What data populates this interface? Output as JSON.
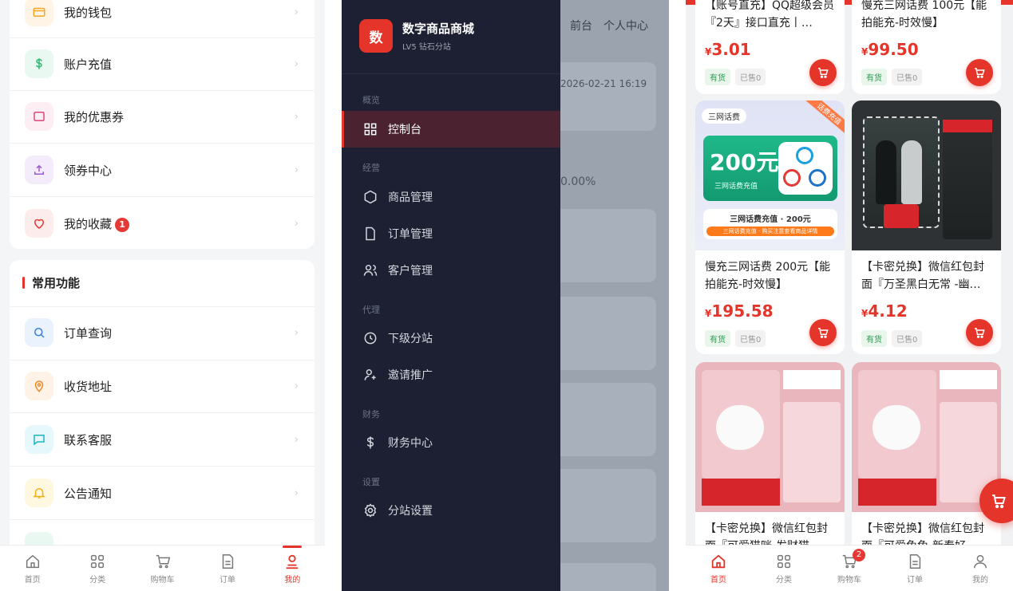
{
  "profile": {
    "account_items": [
      {
        "label": "我的钱包",
        "icon": "wallet-icon",
        "color": "#f5a623",
        "bg": "#fff4e6"
      },
      {
        "label": "账户充值",
        "icon": "dollar-icon",
        "color": "#2eb872",
        "bg": "#e9f8f0"
      },
      {
        "label": "我的优惠券",
        "icon": "coupon-icon",
        "color": "#e0457b",
        "bg": "#fdeef3"
      },
      {
        "label": "领券中心",
        "icon": "upload-icon",
        "color": "#9b59d0",
        "bg": "#f4ecfb"
      },
      {
        "label": "我的收藏",
        "icon": "heart-icon",
        "color": "#e53935",
        "bg": "#fdecec",
        "badge": "1"
      }
    ],
    "common_title": "常用功能",
    "common_items": [
      {
        "label": "订单查询",
        "icon": "search-icon",
        "color": "#3b7ddd",
        "bg": "#eaf2fd"
      },
      {
        "label": "收货地址",
        "icon": "location-icon",
        "color": "#f08a24",
        "bg": "#fff2e6"
      },
      {
        "label": "联系客服",
        "icon": "chat-icon",
        "color": "#1bb3c9",
        "bg": "#e6f8fb"
      },
      {
        "label": "公告通知",
        "icon": "bell-icon",
        "color": "#f5b014",
        "bg": "#fff8e1"
      }
    ],
    "chevron": "›"
  },
  "tabbar_left": {
    "tabs": [
      {
        "label": "首页",
        "icon": "home-icon"
      },
      {
        "label": "分类",
        "icon": "category-icon"
      },
      {
        "label": "购物车",
        "icon": "cart-icon"
      },
      {
        "label": "订单",
        "icon": "order-icon"
      },
      {
        "label": "我的",
        "icon": "user-icon",
        "active": true
      }
    ]
  },
  "admin": {
    "logo_char": "数",
    "site_name": "数字商品商城",
    "site_level": "LV5 钻石分站",
    "nav_top": [
      "前台",
      "个人中心"
    ],
    "bg_date": "2026-02-21 16:19",
    "bg_percent": "0.00%",
    "groups": [
      {
        "title": "概览",
        "items": [
          {
            "label": "控制台",
            "icon": "dashboard-icon",
            "active": true
          }
        ]
      },
      {
        "title": "经营",
        "items": [
          {
            "label": "商品管理",
            "icon": "hexagon-icon"
          },
          {
            "label": "订单管理",
            "icon": "file-icon"
          },
          {
            "label": "客户管理",
            "icon": "users-icon"
          }
        ]
      },
      {
        "title": "代理",
        "items": [
          {
            "label": "下级分站",
            "icon": "clock-icon"
          },
          {
            "label": "邀请推广",
            "icon": "user-plus-icon"
          }
        ]
      },
      {
        "title": "财务",
        "items": [
          {
            "label": "财务中心",
            "icon": "dollar-icon"
          }
        ]
      },
      {
        "title": "设置",
        "items": [
          {
            "label": "分站设置",
            "icon": "gear-icon"
          }
        ]
      }
    ]
  },
  "shop": {
    "currency": "¥",
    "products": [
      {
        "name": "【账号直充】QQ超级会员『2天』接口直充丨…",
        "price": "3.01",
        "stock": "有货",
        "sold": "已售0"
      },
      {
        "name": "慢充三网话费 100元【能拍能充-时效慢】",
        "price": "99.50",
        "stock": "有货",
        "sold": "已售0"
      },
      {
        "name": "慢充三网话费 200元【能拍能充-时效慢】",
        "price": "195.58",
        "stock": "有货",
        "sold": "已售0"
      },
      {
        "name": "【卡密兑换】微信红包封面『万圣黑白无常 -幽…",
        "price": "4.12",
        "stock": "有货",
        "sold": "已售0"
      },
      {
        "name": "【卡密兑换】微信红包封面『可爱猫咪-发财猫…",
        "price": "",
        "stock": "",
        "sold": ""
      },
      {
        "name": "【卡密兑换】微信红包封面『可爱兔兔-新春好…",
        "price": "",
        "stock": "",
        "sold": ""
      }
    ],
    "phone_card": {
      "badge": "三网话费",
      "amount": "200元",
      "caption": "三网话费充值",
      "ribbon": "话费充值",
      "footer": "三网话费充值 · 200元",
      "note": "三网话费充值 · 购买注意查看商品详情"
    }
  },
  "tabbar_right": {
    "tabs": [
      {
        "label": "首页",
        "icon": "home-icon",
        "active": true
      },
      {
        "label": "分类",
        "icon": "category-icon"
      },
      {
        "label": "购物车",
        "icon": "cart-icon",
        "badge": "2"
      },
      {
        "label": "订单",
        "icon": "order-icon"
      },
      {
        "label": "我的",
        "icon": "user-icon"
      }
    ]
  }
}
